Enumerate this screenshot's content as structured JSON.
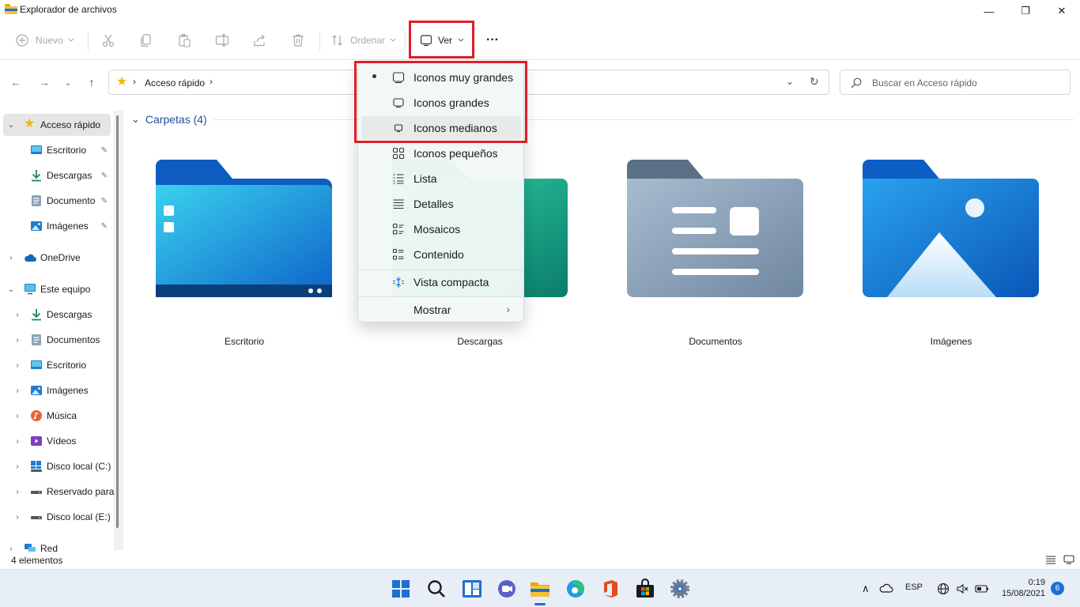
{
  "window": {
    "title": "Explorador de archivos",
    "minimize_glyph": "—",
    "maximize_glyph": "❐",
    "close_glyph": "✕"
  },
  "toolbar": {
    "new_label": "Nuevo",
    "sort_label": "Ordenar",
    "view_label": "Ver",
    "more_label": "···"
  },
  "address": {
    "root_icon": "star-icon",
    "path": "Acceso rápido",
    "sep": "›",
    "dropdown_glyph": "⌄",
    "refresh_glyph": "↻"
  },
  "search": {
    "placeholder": "Buscar en Acceso rápido"
  },
  "nav_glyphs": {
    "back": "←",
    "forward": "→",
    "recent": "⌄",
    "up": "↑"
  },
  "sidebar": {
    "items": [
      {
        "label": "Acceso rápido",
        "icon": "star-icon",
        "expanded": true,
        "selected": true
      },
      {
        "label": "Escritorio",
        "icon": "desktop-icon",
        "pinned": true
      },
      {
        "label": "Descargas",
        "icon": "download-icon",
        "pinned": true
      },
      {
        "label": "Documento",
        "icon": "document-icon",
        "pinned": true
      },
      {
        "label": "Imágenes",
        "icon": "pictures-icon",
        "pinned": true
      },
      {
        "label": "OneDrive",
        "icon": "cloud-icon"
      },
      {
        "label": "Este equipo",
        "icon": "pc-icon",
        "expanded": true
      },
      {
        "label": "Descargas",
        "icon": "download-icon"
      },
      {
        "label": "Documentos",
        "icon": "document-icon"
      },
      {
        "label": "Escritorio",
        "icon": "desktop-icon"
      },
      {
        "label": "Imágenes",
        "icon": "pictures-icon"
      },
      {
        "label": "Música",
        "icon": "music-icon"
      },
      {
        "label": "Vídeos",
        "icon": "video-icon"
      },
      {
        "label": "Disco local (C:)",
        "icon": "windows-drive-icon"
      },
      {
        "label": "Reservado para",
        "icon": "drive-icon"
      },
      {
        "label": "Disco local (E:)",
        "icon": "drive-icon"
      },
      {
        "label": "Red",
        "icon": "network-icon"
      }
    ],
    "pin_glyph": "📌",
    "chevron_open": "⌄",
    "chevron_closed": "›"
  },
  "content": {
    "group_title": "Carpetas (4)",
    "group_chevron": "⌄",
    "folders": [
      {
        "name": "Escritorio"
      },
      {
        "name": "Descargas"
      },
      {
        "name": "Documentos"
      },
      {
        "name": "Imágenes"
      }
    ]
  },
  "status": {
    "item_count": "4 elementos"
  },
  "view_menu": {
    "items": [
      {
        "label": "Iconos muy grandes",
        "icon": "extra-large-icons-icon",
        "selected": true
      },
      {
        "label": "Iconos grandes",
        "icon": "large-icons-icon"
      },
      {
        "label": "Iconos medianos",
        "icon": "medium-icons-icon",
        "hover": true
      },
      {
        "label": "Iconos pequeños",
        "icon": "small-icons-icon"
      },
      {
        "label": "Lista",
        "icon": "list-icon"
      },
      {
        "label": "Detalles",
        "icon": "details-icon"
      },
      {
        "label": "Mosaicos",
        "icon": "tiles-icon"
      },
      {
        "label": "Contenido",
        "icon": "content-icon"
      },
      {
        "label": "Vista compacta",
        "icon": "compact-view-icon"
      },
      {
        "label": "Mostrar",
        "icon": "",
        "submenu": true
      }
    ],
    "submenu_arrow": "›"
  },
  "taskbar": {
    "icons": [
      "start-icon",
      "search-icon",
      "widgets-icon",
      "chat-icon",
      "file-explorer-icon",
      "edge-icon",
      "office-icon",
      "store-icon",
      "settings-icon"
    ],
    "tray": {
      "overflow_glyph": "∧",
      "language": "ESP",
      "time": "0:19",
      "date": "15/08/2021",
      "notifications": "6"
    }
  },
  "colors": {
    "highlight_box": "#e01e2a",
    "accent": "#1e6fd1",
    "folder_header": "#1e4f9c"
  }
}
